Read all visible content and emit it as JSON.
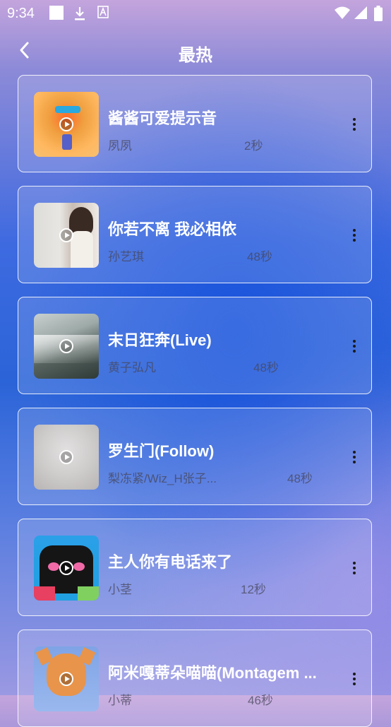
{
  "status": {
    "time": "9:34"
  },
  "header": {
    "title": "最热"
  },
  "items": [
    {
      "title": "酱酱可爱提示音",
      "artist": "夙夙",
      "duration": "2秒"
    },
    {
      "title": "你若不离 我必相依",
      "artist": "孙艺琪",
      "duration": "48秒"
    },
    {
      "title": "末日狂奔(Live)",
      "artist": "黄子弘凡",
      "duration": "48秒"
    },
    {
      "title": "罗生门(Follow)",
      "artist": "梨冻紧/Wiz_H张子...",
      "duration": "48秒"
    },
    {
      "title": "主人你有电话来了",
      "artist": "小茎",
      "duration": "12秒"
    },
    {
      "title": "阿米嘎蒂朵喵喵(Montagem ...",
      "artist": "小蒂",
      "duration": "46秒"
    }
  ]
}
